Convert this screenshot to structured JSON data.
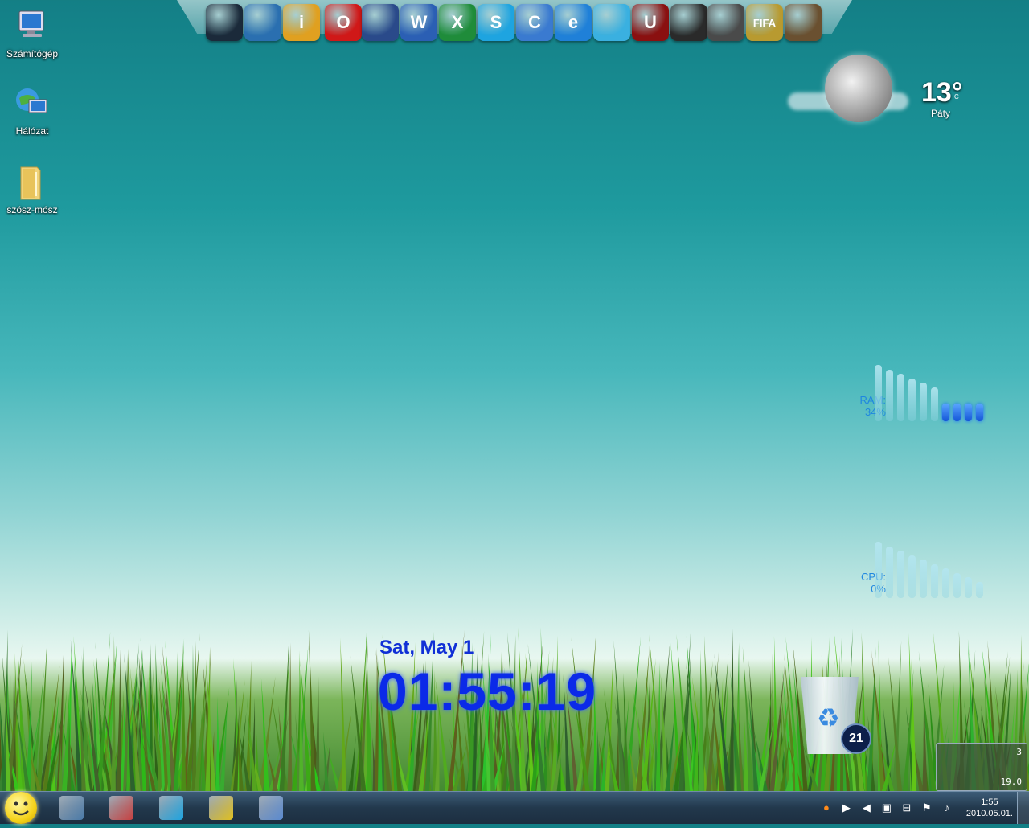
{
  "desktop_icons": [
    {
      "label": "Számítógép",
      "icon": "computer-icon"
    },
    {
      "label": "Hálózat",
      "icon": "network-icon"
    },
    {
      "label": "szósz-mósz",
      "icon": "folder-icon"
    }
  ],
  "dock": {
    "items": [
      {
        "icon": "computer-icon",
        "color": "#1b2a3a"
      },
      {
        "icon": "network-icon",
        "color": "#2a6fb0"
      },
      {
        "icon": "info-icon",
        "color": "#e0a020",
        "glyph": "i"
      },
      {
        "icon": "opera-icon",
        "color": "#d01818",
        "glyph": "O"
      },
      {
        "icon": "steam-icon",
        "color": "#2a4a8a"
      },
      {
        "icon": "word-icon",
        "color": "#2b5fb4",
        "glyph": "W"
      },
      {
        "icon": "excel-icon",
        "color": "#1f8c3a",
        "glyph": "X"
      },
      {
        "icon": "skype-icon",
        "color": "#1ea4e0",
        "glyph": "S"
      },
      {
        "icon": "ccleaner-icon",
        "color": "#3a7ad0",
        "glyph": "C"
      },
      {
        "icon": "internet-explorer-icon",
        "color": "#1f80d8",
        "glyph": "e"
      },
      {
        "icon": "messenger-icon",
        "color": "#3ab0e0"
      },
      {
        "icon": "unreal-icon",
        "color": "#8a1010",
        "glyph": "U"
      },
      {
        "icon": "game-soldier-icon",
        "color": "#2a2a2a"
      },
      {
        "icon": "crysis-icon",
        "color": "#4a4a4a"
      },
      {
        "icon": "fifa-icon",
        "color": "#b89a30",
        "glyph": "FIFA"
      },
      {
        "icon": "gta-icon",
        "color": "#6a5030"
      }
    ]
  },
  "weather": {
    "temp": "13°",
    "unit": "C",
    "city": "Páty"
  },
  "ram_meter": {
    "label": "RAM:",
    "value": "34%",
    "fraction": 0.34
  },
  "cpu_meter": {
    "label": "CPU:",
    "value": "0%",
    "fraction": 0.0
  },
  "clock": {
    "date": "Sat, May 1",
    "time": "01:55:19"
  },
  "recycle_bin": {
    "count": "21"
  },
  "mini_gadget": {
    "top_value": "3",
    "bottom_value": "19.0"
  },
  "taskbar": {
    "start_icon": "smiley-start-icon",
    "buttons": [
      {
        "icon": "remote-desktop-icon",
        "color": "#4a7aa8"
      },
      {
        "icon": "disk-manager-icon",
        "color": "#c84040"
      },
      {
        "icon": "skype-icon",
        "color": "#1ea4e0"
      },
      {
        "icon": "network-tool-icon",
        "color": "#e0c020"
      },
      {
        "icon": "settings-shield-icon",
        "color": "#5a8ad0"
      }
    ]
  },
  "tray": {
    "icons": [
      "avast-icon",
      "media-icon",
      "volume-warning-icon",
      "monitor-icon",
      "network-tray-icon",
      "flag-icon",
      "speaker-icon"
    ],
    "time": "1:55",
    "date": "2010.05.01."
  }
}
